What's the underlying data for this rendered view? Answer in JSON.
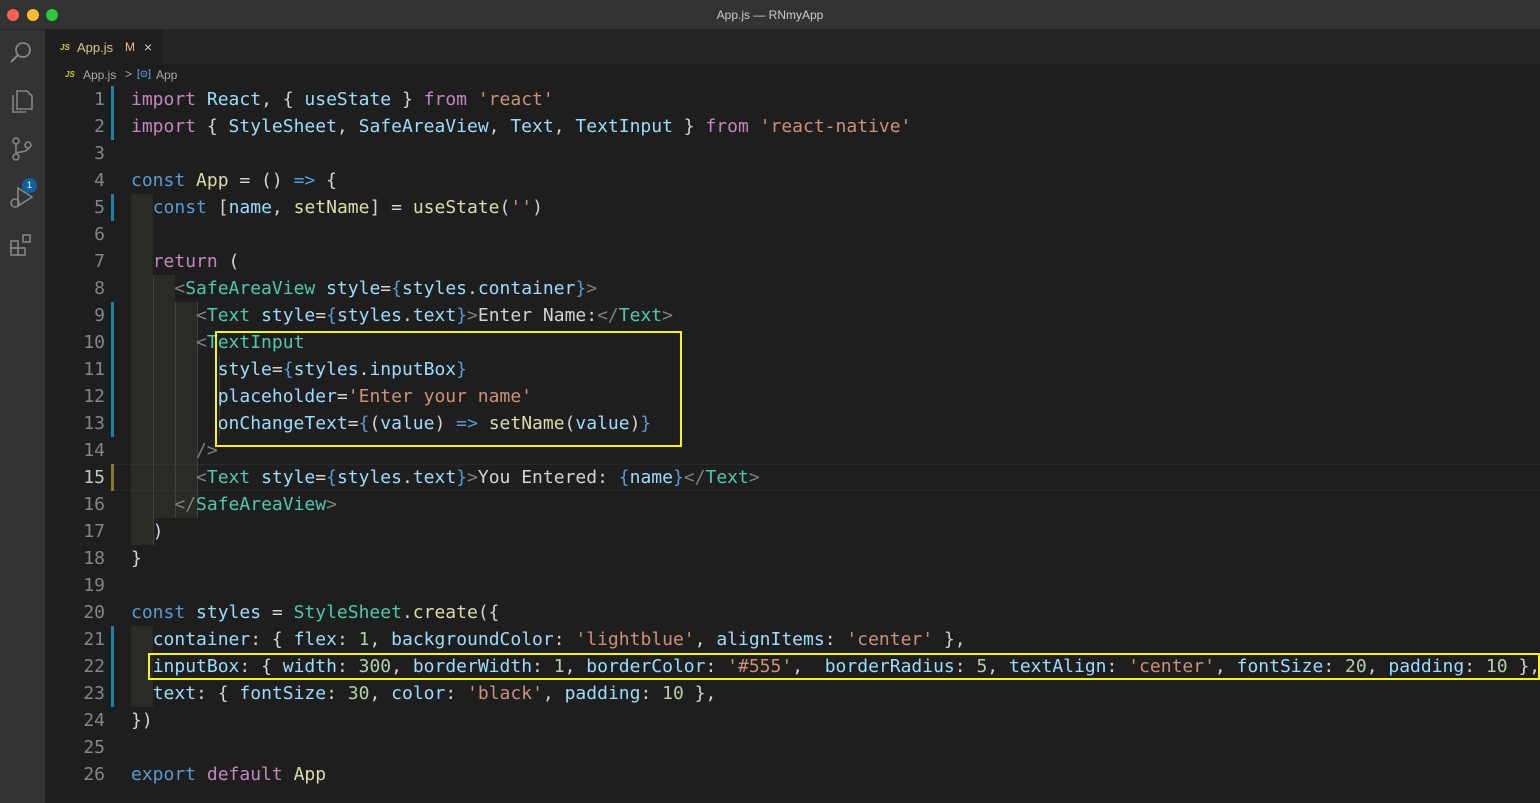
{
  "window": {
    "title": "App.js — RNmyApp"
  },
  "activity_bar": {
    "items": [
      "search-icon",
      "files-icon",
      "source-control-icon",
      "run-debug-icon",
      "extensions-icon"
    ],
    "source_control_badge": "1"
  },
  "tab": {
    "icon": "JS",
    "name": "App.js",
    "status": "M",
    "close": "×"
  },
  "breadcrumb": {
    "icon": "JS",
    "file": "App.js",
    "separator": ">",
    "symbol_icon": "[⊙]",
    "symbol": "App"
  },
  "line_numbers": [
    "1",
    "2",
    "3",
    "4",
    "5",
    "6",
    "7",
    "8",
    "9",
    "10",
    "11",
    "12",
    "13",
    "14",
    "15",
    "16",
    "17",
    "18",
    "19",
    "20",
    "21",
    "22",
    "23",
    "24",
    "25",
    "26"
  ],
  "lines": [
    [
      [
        "kwc",
        "import"
      ],
      [
        "pun",
        " "
      ],
      [
        "var",
        "React"
      ],
      [
        "pun",
        ", { "
      ],
      [
        "var",
        "useState"
      ],
      [
        "pun",
        " } "
      ],
      [
        "kwc",
        "from"
      ],
      [
        "pun",
        " "
      ],
      [
        "str",
        "'react'"
      ]
    ],
    [
      [
        "kwc",
        "import"
      ],
      [
        "pun",
        " { "
      ],
      [
        "var",
        "StyleSheet"
      ],
      [
        "pun",
        ", "
      ],
      [
        "var",
        "SafeAreaView"
      ],
      [
        "pun",
        ", "
      ],
      [
        "var",
        "Text"
      ],
      [
        "pun",
        ", "
      ],
      [
        "var",
        "TextInput"
      ],
      [
        "pun",
        " } "
      ],
      [
        "kwc",
        "from"
      ],
      [
        "pun",
        " "
      ],
      [
        "str",
        "'react-native'"
      ]
    ],
    [],
    [
      [
        "kw",
        "const"
      ],
      [
        "pun",
        " "
      ],
      [
        "fn",
        "App"
      ],
      [
        "pun",
        " = () "
      ],
      [
        "kw",
        "=>"
      ],
      [
        "pun",
        " {"
      ]
    ],
    [
      [
        "pun",
        "  "
      ],
      [
        "kw",
        "const"
      ],
      [
        "pun",
        " ["
      ],
      [
        "var",
        "name"
      ],
      [
        "pun",
        ", "
      ],
      [
        "fn",
        "setName"
      ],
      [
        "pun",
        "] = "
      ],
      [
        "fn",
        "useState"
      ],
      [
        "pun",
        "("
      ],
      [
        "str",
        "''"
      ],
      [
        "pun",
        ")"
      ]
    ],
    [],
    [
      [
        "pun",
        "  "
      ],
      [
        "kwc",
        "return"
      ],
      [
        "pun",
        " ("
      ]
    ],
    [
      [
        "pun",
        "    "
      ],
      [
        "tag",
        "<"
      ],
      [
        "typ",
        "SafeAreaView"
      ],
      [
        "pun",
        " "
      ],
      [
        "var",
        "style"
      ],
      [
        "pun",
        "="
      ],
      [
        "kw",
        "{"
      ],
      [
        "var",
        "styles"
      ],
      [
        "pun",
        "."
      ],
      [
        "var",
        "container"
      ],
      [
        "kw",
        "}"
      ],
      [
        "tag",
        ">"
      ]
    ],
    [
      [
        "pun",
        "      "
      ],
      [
        "tag",
        "<"
      ],
      [
        "typ",
        "Text"
      ],
      [
        "pun",
        " "
      ],
      [
        "var",
        "style"
      ],
      [
        "pun",
        "="
      ],
      [
        "kw",
        "{"
      ],
      [
        "var",
        "styles"
      ],
      [
        "pun",
        "."
      ],
      [
        "var",
        "text"
      ],
      [
        "kw",
        "}"
      ],
      [
        "tag",
        ">"
      ],
      [
        "pun",
        "Enter Name:"
      ],
      [
        "tag",
        "</"
      ],
      [
        "typ",
        "Text"
      ],
      [
        "tag",
        ">"
      ]
    ],
    [
      [
        "pun",
        "      "
      ],
      [
        "tag",
        "<"
      ],
      [
        "typ",
        "TextInput"
      ]
    ],
    [
      [
        "pun",
        "        "
      ],
      [
        "var",
        "style"
      ],
      [
        "pun",
        "="
      ],
      [
        "kw",
        "{"
      ],
      [
        "var",
        "styles"
      ],
      [
        "pun",
        "."
      ],
      [
        "var",
        "inputBox"
      ],
      [
        "kw",
        "}"
      ]
    ],
    [
      [
        "pun",
        "        "
      ],
      [
        "var",
        "placeholder"
      ],
      [
        "pun",
        "="
      ],
      [
        "str",
        "'Enter your name'"
      ]
    ],
    [
      [
        "pun",
        "        "
      ],
      [
        "var",
        "onChangeText"
      ],
      [
        "pun",
        "="
      ],
      [
        "kw",
        "{"
      ],
      [
        "pun",
        "("
      ],
      [
        "var",
        "value"
      ],
      [
        "pun",
        ") "
      ],
      [
        "kw",
        "=>"
      ],
      [
        "pun",
        " "
      ],
      [
        "fn",
        "setName"
      ],
      [
        "pun",
        "("
      ],
      [
        "var",
        "value"
      ],
      [
        "pun",
        ")"
      ],
      [
        "kw",
        "}"
      ]
    ],
    [
      [
        "pun",
        "      "
      ],
      [
        "tag",
        "/>"
      ]
    ],
    [
      [
        "pun",
        "      "
      ],
      [
        "tag",
        "<"
      ],
      [
        "typ",
        "Text"
      ],
      [
        "pun",
        " "
      ],
      [
        "var",
        "style"
      ],
      [
        "pun",
        "="
      ],
      [
        "kw",
        "{"
      ],
      [
        "var",
        "styles"
      ],
      [
        "pun",
        "."
      ],
      [
        "var",
        "text"
      ],
      [
        "kw",
        "}"
      ],
      [
        "tag",
        ">"
      ],
      [
        "pun",
        "You Entered: "
      ],
      [
        "kw",
        "{"
      ],
      [
        "var",
        "name"
      ],
      [
        "kw",
        "}"
      ],
      [
        "tag",
        "<"
      ],
      [
        "tag",
        "/"
      ],
      [
        "typ",
        "Text"
      ],
      [
        "tag",
        ">"
      ]
    ],
    [
      [
        "pun",
        "    "
      ],
      [
        "tag",
        "</"
      ],
      [
        "typ",
        "SafeAreaView"
      ],
      [
        "tag",
        ">"
      ]
    ],
    [
      [
        "pun",
        "  )"
      ]
    ],
    [
      [
        "pun",
        "}"
      ]
    ],
    [],
    [
      [
        "kw",
        "const"
      ],
      [
        "pun",
        " "
      ],
      [
        "var",
        "styles"
      ],
      [
        "pun",
        " = "
      ],
      [
        "typ",
        "StyleSheet"
      ],
      [
        "pun",
        "."
      ],
      [
        "fn",
        "create"
      ],
      [
        "pun",
        "({"
      ]
    ],
    [
      [
        "pun",
        "  "
      ],
      [
        "var",
        "container"
      ],
      [
        "pun",
        ": { "
      ],
      [
        "var",
        "flex"
      ],
      [
        "pun",
        ": "
      ],
      [
        "num",
        "1"
      ],
      [
        "pun",
        ", "
      ],
      [
        "var",
        "backgroundColor"
      ],
      [
        "pun",
        ": "
      ],
      [
        "str",
        "'lightblue'"
      ],
      [
        "pun",
        ", "
      ],
      [
        "var",
        "alignItems"
      ],
      [
        "pun",
        ": "
      ],
      [
        "str",
        "'center'"
      ],
      [
        "pun",
        " },"
      ]
    ],
    [
      [
        "pun",
        "  "
      ],
      [
        "var",
        "inputBox"
      ],
      [
        "pun",
        ": { "
      ],
      [
        "var",
        "width"
      ],
      [
        "pun",
        ": "
      ],
      [
        "num",
        "300"
      ],
      [
        "pun",
        ", "
      ],
      [
        "var",
        "borderWidth"
      ],
      [
        "pun",
        ": "
      ],
      [
        "num",
        "1"
      ],
      [
        "pun",
        ", "
      ],
      [
        "var",
        "borderColor"
      ],
      [
        "pun",
        ": "
      ],
      [
        "str",
        "'#555'"
      ],
      [
        "pun",
        ",  "
      ],
      [
        "var",
        "borderRadius"
      ],
      [
        "pun",
        ": "
      ],
      [
        "num",
        "5"
      ],
      [
        "pun",
        ", "
      ],
      [
        "var",
        "textAlign"
      ],
      [
        "pun",
        ": "
      ],
      [
        "str",
        "'center'"
      ],
      [
        "pun",
        ", "
      ],
      [
        "var",
        "fontSize"
      ],
      [
        "pun",
        ": "
      ],
      [
        "num",
        "20"
      ],
      [
        "pun",
        ", "
      ],
      [
        "var",
        "padding"
      ],
      [
        "pun",
        ": "
      ],
      [
        "num",
        "10"
      ],
      [
        "pun",
        " },"
      ]
    ],
    [
      [
        "pun",
        "  "
      ],
      [
        "var",
        "text"
      ],
      [
        "pun",
        ": { "
      ],
      [
        "var",
        "fontSize"
      ],
      [
        "pun",
        ": "
      ],
      [
        "num",
        "30"
      ],
      [
        "pun",
        ", "
      ],
      [
        "var",
        "color"
      ],
      [
        "pun",
        ": "
      ],
      [
        "str",
        "'black'"
      ],
      [
        "pun",
        ", "
      ],
      [
        "var",
        "padding"
      ],
      [
        "pun",
        ": "
      ],
      [
        "num",
        "10"
      ],
      [
        "pun",
        " },"
      ]
    ],
    [
      [
        "pun",
        "})"
      ]
    ],
    [],
    [
      [
        "kw",
        "export"
      ],
      [
        "pun",
        " "
      ],
      [
        "kwc",
        "default"
      ],
      [
        "pun",
        " "
      ],
      [
        "fn",
        "App"
      ]
    ]
  ],
  "colors": {
    "keyword": "#569cd6",
    "control": "#c586c0",
    "variable": "#9cdcfe",
    "function": "#dcdcaa",
    "string": "#ce9178",
    "type": "#4ec9b0",
    "number": "#b5cea8",
    "highlight_box": "#f3f31f"
  }
}
